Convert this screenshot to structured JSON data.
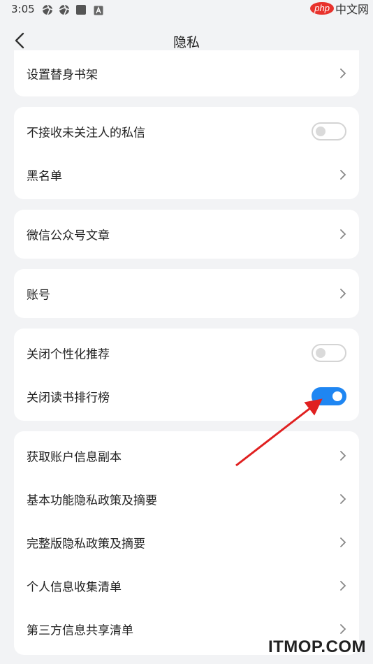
{
  "status_bar": {
    "time": "3:05",
    "icons": [
      "aperture-icon",
      "aperture-icon",
      "square-icon",
      "a-box-icon"
    ]
  },
  "watermark_php": {
    "php": "php",
    "cn": "中文网"
  },
  "header": {
    "back_icon": "chevron-left-icon",
    "title": "隐私"
  },
  "sections": {
    "s1": {
      "items": [
        {
          "label": "设置替身书架",
          "type": "link"
        }
      ]
    },
    "s2": {
      "items": [
        {
          "label": "不接收未关注人的私信",
          "type": "toggle",
          "on": false
        },
        {
          "label": "黑名单",
          "type": "link"
        }
      ]
    },
    "s3": {
      "items": [
        {
          "label": "微信公众号文章",
          "type": "link"
        }
      ]
    },
    "s4": {
      "items": [
        {
          "label": "账号",
          "type": "link"
        }
      ]
    },
    "s5": {
      "items": [
        {
          "label": "关闭个性化推荐",
          "type": "toggle",
          "on": false
        },
        {
          "label": "关闭读书排行榜",
          "type": "toggle",
          "on": true
        }
      ]
    },
    "s6": {
      "items": [
        {
          "label": "获取账户信息副本",
          "type": "link"
        },
        {
          "label": "基本功能隐私政策及摘要",
          "type": "link"
        },
        {
          "label": "完整版隐私政策及摘要",
          "type": "link"
        },
        {
          "label": "个人信息收集清单",
          "type": "link"
        },
        {
          "label": "第三方信息共享清单",
          "type": "link"
        }
      ]
    }
  },
  "annotation": {
    "arrow_color": "#e02020"
  },
  "watermark_itmop": {
    "text": "ITMOP.COM"
  },
  "colors": {
    "toggle_on": "#1f86f2",
    "background": "#f2f3f5",
    "card": "#ffffff"
  }
}
